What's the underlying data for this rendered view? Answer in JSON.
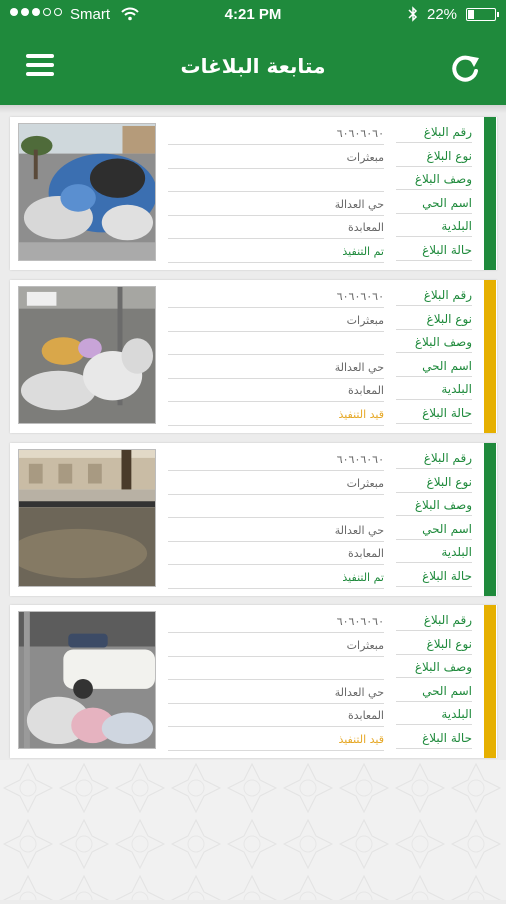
{
  "status_bar": {
    "carrier": "Smart",
    "time": "4:21 PM",
    "battery": "22%",
    "battery_level": 0.22,
    "signal_bars": 3
  },
  "header": {
    "title": "متابعة البلاغات",
    "menu_icon": "hamburger-menu-icon",
    "refresh_icon": "refresh-icon",
    "color": "#1f8a3c"
  },
  "field_labels": {
    "number": "رقم البلاغ",
    "type": "نوع البلاغ",
    "description": "وصف البلاغ",
    "district": "اسم الحي",
    "municipality": "البلدية",
    "status": "حالة البلاغ"
  },
  "status_colors": {
    "done": "#1f8a3c",
    "in_progress": "#e6b000"
  },
  "reports": [
    {
      "number": "٦٠٦٠٦٠٦٠",
      "type": "مبعثرات",
      "description": "",
      "district": "حي العدالة",
      "municipality": "المعابدة",
      "status": "تم التنفيذ",
      "status_key": "done",
      "photo": "garbage-pile-photo"
    },
    {
      "number": "٦٠٦٠٦٠٦٠",
      "type": "مبعثرات",
      "description": "",
      "district": "حي العدالة",
      "municipality": "المعابدة",
      "status": "قيد التنفيذ",
      "status_key": "in_progress",
      "photo": "scattered-trash-photo"
    },
    {
      "number": "٦٠٦٠٦٠٦٠",
      "type": "مبعثرات",
      "description": "",
      "district": "حي العدالة",
      "municipality": "المعابدة",
      "status": "تم التنفيذ",
      "status_key": "done",
      "photo": "flooded-street-photo"
    },
    {
      "number": "٦٠٦٠٦٠٦٠",
      "type": "مبعثرات",
      "description": "",
      "district": "حي العدالة",
      "municipality": "المعابدة",
      "status": "قيد التنفيذ",
      "status_key": "in_progress",
      "photo": "trash-by-car-photo"
    }
  ]
}
